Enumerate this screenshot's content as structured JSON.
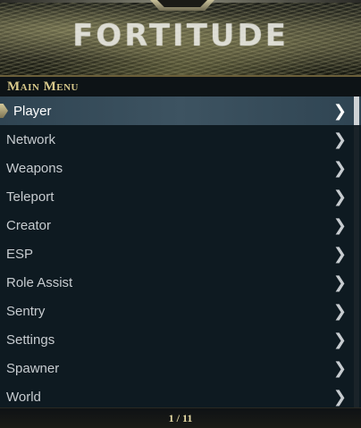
{
  "banner": {
    "title": "FORTITUDE"
  },
  "menu": {
    "section_title": "Main Menu",
    "selected_index": 0,
    "items": [
      {
        "label": "Player"
      },
      {
        "label": "Network"
      },
      {
        "label": "Weapons"
      },
      {
        "label": "Teleport"
      },
      {
        "label": "Creator"
      },
      {
        "label": "ESP"
      },
      {
        "label": "Role Assist"
      },
      {
        "label": "Sentry"
      },
      {
        "label": "Settings"
      },
      {
        "label": "Spawner"
      },
      {
        "label": "World"
      }
    ],
    "chevron": "❯",
    "scroll_position": 0
  },
  "footer": {
    "page_indicator": "1 / 11"
  },
  "colors": {
    "accent_gold": "#d8c98b",
    "selected_bg": "#3d5361",
    "item_text": "#c7ccd0"
  }
}
